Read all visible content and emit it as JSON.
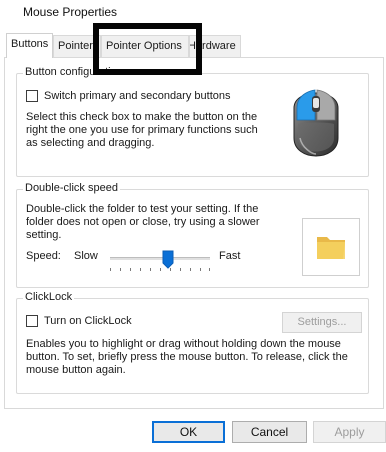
{
  "window": {
    "title": "Mouse Properties"
  },
  "tabs": [
    {
      "label": "Buttons"
    },
    {
      "label": "Pointers"
    },
    {
      "label": "Pointer Options"
    },
    {
      "label": "Hardware"
    }
  ],
  "button_configuration": {
    "legend": "Button configuration",
    "switch_checkbox_label": "Switch primary and secondary buttons",
    "switch_checked": false,
    "description_lines": [
      "Select this check box to make the button on the",
      "right the one you use for primary functions such",
      "as selecting and dragging."
    ]
  },
  "double_click": {
    "legend": "Double-click speed",
    "description_lines": [
      "Double-click the folder to test your setting. If the",
      "folder does not open or close, try using a slower",
      "setting."
    ],
    "speed_label": "Speed:",
    "slow_label": "Slow",
    "fast_label": "Fast",
    "speed_value": 0.58
  },
  "clicklock": {
    "legend": "ClickLock",
    "checkbox_label": "Turn on ClickLock",
    "checked": false,
    "settings_label": "Settings...",
    "description_lines": [
      "Enables you to highlight or drag without holding down the mouse",
      "button. To set, briefly press the mouse button. To release, click the",
      "mouse button again."
    ]
  },
  "footer": {
    "ok_label": "OK",
    "cancel_label": "Cancel",
    "apply_label": "Apply"
  },
  "colors": {
    "accent": "#0a6fd6",
    "highlight_border": "#050505",
    "mouse_button_blue": "#2a9bea"
  }
}
